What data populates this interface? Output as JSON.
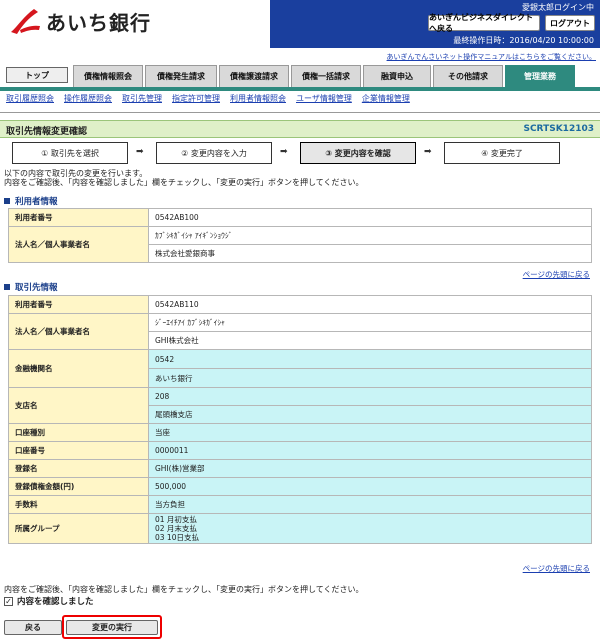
{
  "header": {
    "bank_name": "あいち銀行",
    "user_info": "愛銀太郎ログイン中",
    "biz_direct_button": "あいぎんビジネスダイレクトへ戻る",
    "logout_button": "ログアウト",
    "last_operation": "最終操作日時：2016/04/20 10:00:00",
    "manual_link": "あいぎんでんさいネット操作マニュアルはこちらをご覧ください。"
  },
  "tabs": [
    "トップ",
    "債権情報照会",
    "債権発生請求",
    "債権譲渡請求",
    "債権一括請求",
    "融資申込",
    "その他請求",
    "管理業務"
  ],
  "subnav": [
    "取引履歴照会",
    "操作履歴照会",
    "取引先管理",
    "指定許可管理",
    "利用者情報照会",
    "ユーザ情報管理",
    "企業情報管理"
  ],
  "page": {
    "title": "取引先情報変更確認",
    "screen_code": "SCRTSK12103"
  },
  "steps": [
    "① 取引先を選択",
    "② 変更内容を入力",
    "③ 変更内容を確認",
    "④ 変更完了"
  ],
  "instructions": [
    "以下の内容で取引先の変更を行います。",
    "内容をご確認後、「内容を確認しました」欄をチェックし、「変更の実行」ボタンを押してください。"
  ],
  "user_section": {
    "title": "利用者情報",
    "rows": {
      "user_no_label": "利用者番号",
      "user_no": "0542AB100",
      "name_label": "法人名／個人事業者名",
      "name_kana": "ｶﾌﾞｼｷｶﾞｲｼｬ ｱｲｷﾞﾝｼｮｳｼﾞ",
      "name": "株式会社愛銀商事"
    }
  },
  "partner_section": {
    "title": "取引先情報",
    "rows": {
      "user_no_label": "利用者番号",
      "user_no": "0542AB110",
      "name_label": "法人名／個人事業者名",
      "name_kana": "ｼﾞｰｴｲﾁｱｲ ｶﾌﾞｼｷｶﾞｲｼｬ",
      "name": "GHI株式会社",
      "bank_label": "金融機関名",
      "bank_code": "0542",
      "bank_name": "あいち銀行",
      "branch_label": "支店名",
      "branch_code": "208",
      "branch_name": "尾頭橋支店",
      "acct_type_label": "口座種別",
      "acct_type": "当座",
      "acct_no_label": "口座番号",
      "acct_no": "0000011",
      "reg_name_label": "登録名",
      "reg_name": "GHI(株)営業部",
      "amount_label": "登録債権金額(円)",
      "amount": "500,000",
      "fee_label": "手数料",
      "fee": "当方負担",
      "group_label": "所属グループ",
      "groups": [
        "01 月初支払",
        "02 月末支払",
        "03 10日支払"
      ]
    }
  },
  "to_top_link": "ページの先頭に戻る",
  "confirm": {
    "text": "内容をご確認後、「内容を確認しました」欄をチェックし、「変更の実行」ボタンを押してください。",
    "checkbox_label": "内容を確認しました",
    "checked_mark": "✓"
  },
  "buttons": {
    "back": "戻る",
    "execute": "変更の実行"
  },
  "colors": {
    "header_blue": "#1a3f9e",
    "tab_active": "#2e8a7f",
    "title_bar": "#dff0c8",
    "label_bg": "#fff6c7",
    "changed_bg": "#c9f4f6",
    "highlight": "#ee0000",
    "logo_red": "#d5161e"
  }
}
